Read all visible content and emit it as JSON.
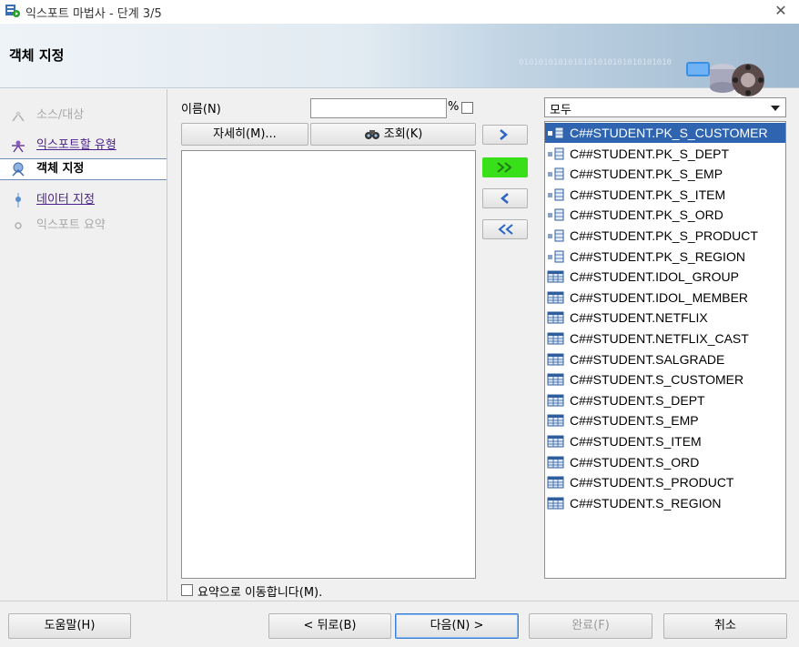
{
  "window": {
    "title": "익스포트 마법사 - 단계 3/5",
    "close": "✕"
  },
  "header": {
    "title": "객체 지정",
    "binary_decoration": "0101010101010101010101010101010"
  },
  "nav": {
    "steps": [
      {
        "label": "소스/대상",
        "state": "disabled"
      },
      {
        "label": "익스포트할 유형",
        "state": "link"
      },
      {
        "label": "객체 지정",
        "state": "current"
      },
      {
        "label": "데이터 지정",
        "state": "link"
      },
      {
        "label": "익스포트 요약",
        "state": "disabled"
      }
    ]
  },
  "form": {
    "name_label": "이름(N)",
    "name_value": "",
    "percent": "%",
    "detail_button": "자세히(M)...",
    "search_button": "조회(K)",
    "move_right": "»",
    "move_all_right": "»»",
    "move_left": "«",
    "move_all_left": "««",
    "summary_checkbox_label": "요약으로 이동합니다(M)."
  },
  "filter": {
    "selected": "모두"
  },
  "selected_objects": [
    {
      "name": "C##STUDENT.PK_S_CUSTOMER",
      "type": "index",
      "selected": true
    },
    {
      "name": "C##STUDENT.PK_S_DEPT",
      "type": "index"
    },
    {
      "name": "C##STUDENT.PK_S_EMP",
      "type": "index"
    },
    {
      "name": "C##STUDENT.PK_S_ITEM",
      "type": "index"
    },
    {
      "name": "C##STUDENT.PK_S_ORD",
      "type": "index"
    },
    {
      "name": "C##STUDENT.PK_S_PRODUCT",
      "type": "index"
    },
    {
      "name": "C##STUDENT.PK_S_REGION",
      "type": "index"
    },
    {
      "name": "C##STUDENT.IDOL_GROUP",
      "type": "table"
    },
    {
      "name": "C##STUDENT.IDOL_MEMBER",
      "type": "table"
    },
    {
      "name": "C##STUDENT.NETFLIX",
      "type": "table"
    },
    {
      "name": "C##STUDENT.NETFLIX_CAST",
      "type": "table"
    },
    {
      "name": "C##STUDENT.SALGRADE",
      "type": "table"
    },
    {
      "name": "C##STUDENT.S_CUSTOMER",
      "type": "table"
    },
    {
      "name": "C##STUDENT.S_DEPT",
      "type": "table"
    },
    {
      "name": "C##STUDENT.S_EMP",
      "type": "table"
    },
    {
      "name": "C##STUDENT.S_ITEM",
      "type": "table"
    },
    {
      "name": "C##STUDENT.S_ORD",
      "type": "table"
    },
    {
      "name": "C##STUDENT.S_PRODUCT",
      "type": "table"
    },
    {
      "name": "C##STUDENT.S_REGION",
      "type": "table"
    }
  ],
  "buttons": {
    "help": "도움말(H)",
    "back": "< 뒤로(B)",
    "next": "다음(N) >",
    "finish": "완료(F)",
    "cancel": "취소"
  },
  "colors": {
    "selection": "#2f65b0",
    "highlight": "#39e01a",
    "link": "#4a1e8c"
  }
}
